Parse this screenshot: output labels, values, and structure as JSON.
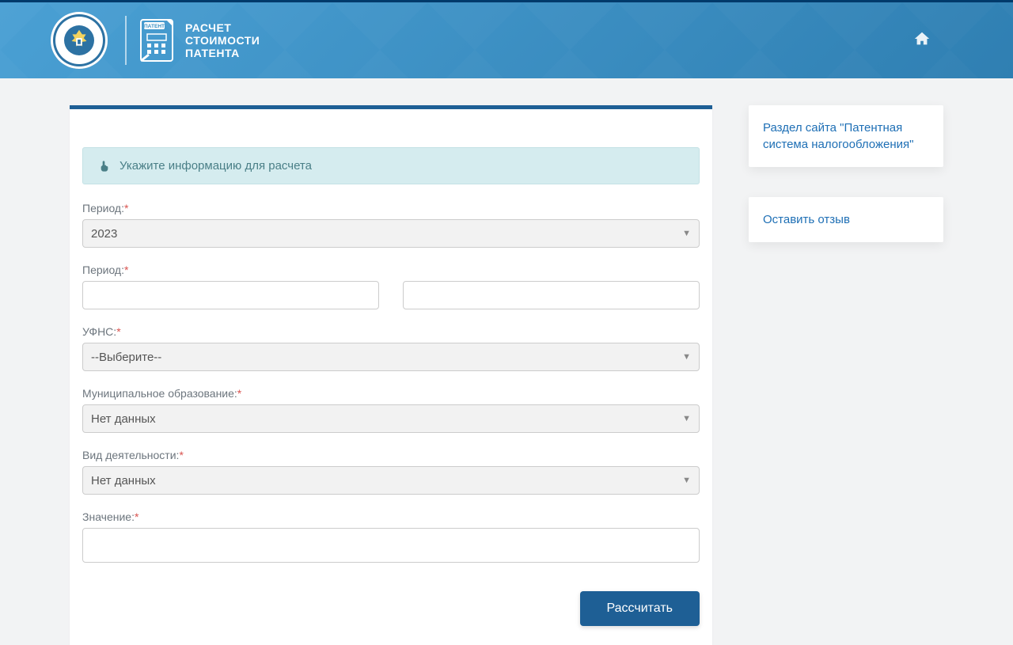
{
  "header": {
    "title_line1": "РАСЧЕТ",
    "title_line2": "СТОИМОСТИ",
    "title_line3": "ПАТЕНТА",
    "patent_badge": "ПАТЕНТ"
  },
  "banner": {
    "text": "Укажите информацию для расчета"
  },
  "form": {
    "period_year_label": "Период:",
    "period_year_value": "2023",
    "period_range_label": "Период:",
    "period_from": "",
    "period_to": "",
    "ufns_label": "УФНС:",
    "ufns_value": "--Выберите--",
    "mo_label": "Муниципальное образование:",
    "mo_value": "Нет данных",
    "activity_label": "Вид деятельности:",
    "activity_value": "Нет данных",
    "value_label": "Значение:",
    "value_value": "",
    "required_mark": "*",
    "submit": "Рассчитать"
  },
  "sidebar": {
    "link1": "Раздел сайта \"Патентная система налогообложения\"",
    "link2": "Оставить отзыв"
  }
}
